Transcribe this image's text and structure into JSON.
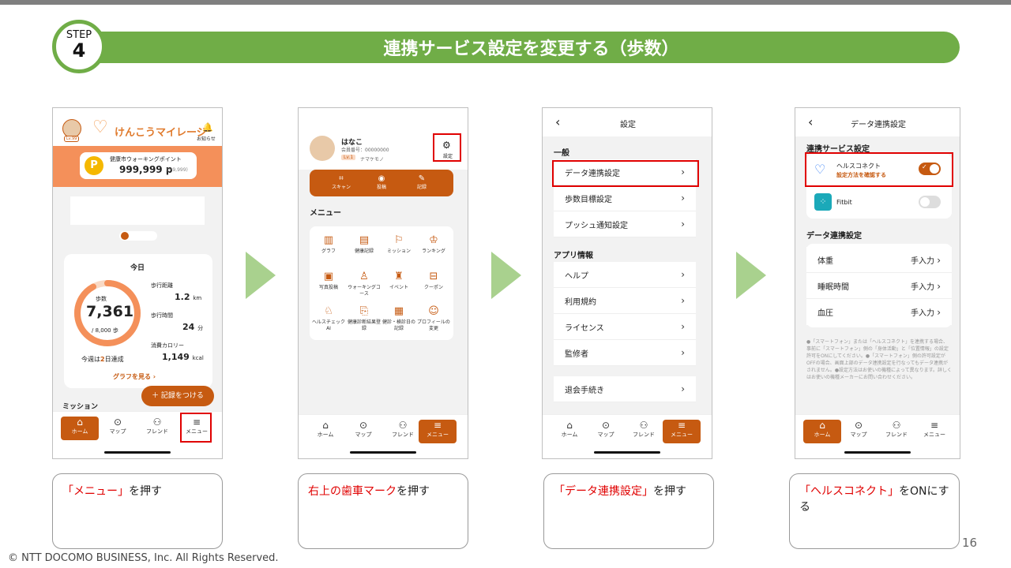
{
  "step": {
    "label": "STEP",
    "number": "4"
  },
  "title": "連携サービス設定を変更する（歩数）",
  "footer": "© NTT DOCOMO BUSINESS, Inc. All Rights Reserved.",
  "page_number": "16",
  "nav": {
    "home": "ホーム",
    "map": "マップ",
    "friend": "フレンド",
    "menu": "メニュー"
  },
  "colors": {
    "accent": "#c65a11",
    "green": "#70ad47",
    "highlight": "#e00000"
  },
  "screen1": {
    "app_name": "けんこうマイレージ",
    "level": "Lv.99",
    "notify": "お知らせ",
    "points_label": "健康市ウォーキングポイント",
    "points": "999,999 p",
    "points_delta": "(+9,999)",
    "today": "今日",
    "steps_label": "歩数",
    "steps": "7,361",
    "steps_goal": "/ 8,000 歩",
    "distance_label": "歩行距離",
    "distance": "1.2",
    "distance_unit": "km",
    "time_label": "歩行時間",
    "time": "24",
    "time_unit": "分",
    "cal_label": "消費カロリー",
    "cal": "1,149",
    "cal_unit": "kcal",
    "week_pre": "今週は",
    "week_num": "2",
    "week_post": "日達成",
    "graph_link": "グラフを見る ›",
    "record_btn": "＋ 記録をつける",
    "mission": "ミッション",
    "progress": 0.92
  },
  "screen2": {
    "name": "はなこ",
    "member": "会員番号：00000000",
    "level": "Lv.1",
    "nickname": "ナマケモノ",
    "settings": "設定",
    "quick": [
      "スキャン",
      "投稿",
      "記録"
    ],
    "menu_title": "メニュー",
    "items": [
      "グラフ",
      "健康記録",
      "ミッション",
      "ランキング",
      "写真投稿",
      "ウォーキングコース",
      "イベント",
      "クーポン",
      "ヘルスチェックAI",
      "健康診断結果登録",
      "健診・検診日の記録",
      "プロフィールの変更"
    ]
  },
  "screen3": {
    "title": "設定",
    "sec1": "一般",
    "sec1_items": [
      "データ連携設定",
      "歩数目標設定",
      "プッシュ通知設定"
    ],
    "sec2": "アプリ情報",
    "sec2_items": [
      "ヘルプ",
      "利用規約",
      "ライセンス",
      "監修者"
    ],
    "withdraw": "退会手続き"
  },
  "screen4": {
    "title": "データ連携設定",
    "sec1": "連携サービス設定",
    "hc_name": "ヘルスコネクト",
    "hc_sub": "設定方法を確認する",
    "fitbit": "Fitbit",
    "sec2": "データ連携設定",
    "rows": [
      {
        "label": "体重",
        "value": "手入力"
      },
      {
        "label": "睡眠時間",
        "value": "手入力"
      },
      {
        "label": "血圧",
        "value": "手入力"
      }
    ],
    "note": "●「スマートフォン」または「ヘルスコネクト」を連携する場合、事前に「スマートフォン」側の「身体活動」と「位置情報」の設定許可をONにしてください。●「スマートフォン」側の許可設定がOFFの場合、画面上部のデータ連携設定を行なってもデータ連携がされません。●設定方法はお使いの機種によって異なります。詳しくはお使いの機種メーカーにお問い合わせください。"
  },
  "captions": [
    {
      "red": "「メニュー」",
      "black": "を押す"
    },
    {
      "red": "右上の歯車マーク",
      "black": "を押す"
    },
    {
      "red": "「データ連携設定」",
      "black": "を押す"
    },
    {
      "red": "「ヘルスコネクト」",
      "black": "をONにする"
    }
  ]
}
